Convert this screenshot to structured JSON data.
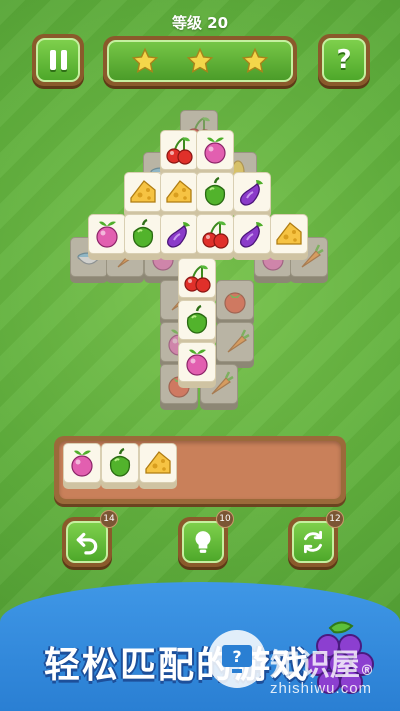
{
  "header": {
    "level_label": "等级 20",
    "stars_earned": 3,
    "help_label": "?"
  },
  "tray": {
    "capacity": 7,
    "tiles": [
      "radish",
      "pepper",
      "cheese"
    ]
  },
  "powerups": [
    {
      "name": "undo",
      "count": "14"
    },
    {
      "name": "hint",
      "count": "10"
    },
    {
      "name": "shuffle",
      "count": "12"
    }
  ],
  "banner": {
    "slogan": "轻松匹配的游戏"
  },
  "watermark": {
    "title": "知识屋",
    "registered": "®",
    "url": "zhishiwu.com",
    "icon_label": "?"
  },
  "colors": {
    "board_green": "#5fae3c",
    "button_green": "#4ea82a",
    "wood": "#8a5a2b",
    "tray_fill": "#c9805a",
    "banner_blue": "#2a7fd3",
    "star_yellow": "#f4d64a"
  }
}
